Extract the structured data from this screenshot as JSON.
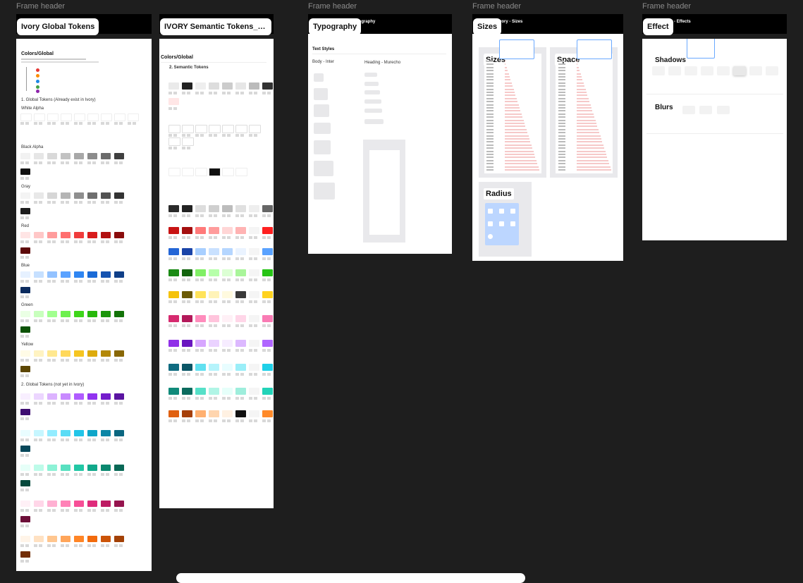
{
  "frame_header_label": "Frame header",
  "frames": {
    "global": {
      "label": "Ivory Global Tokens",
      "title": "Colors/Global",
      "section1": "1. Global Tokens (Already exist in Ivory)",
      "section2": "2. Global Tokens (not yet in Ivory)",
      "groups": [
        "White Alpha",
        "Black Alpha",
        "Gray",
        "Red",
        "Blue",
        "Green",
        "Yellow"
      ]
    },
    "semantic": {
      "label": "IVORY Semantic Tokens_li...",
      "title": "Colors/Global",
      "section": "2. Semantic Tokens"
    },
    "typography": {
      "label": "Typography",
      "section": "Text Styles",
      "col1": "Body - Inter",
      "col2": "Heading - Murecho",
      "hbar_title": "pography"
    },
    "sizes": {
      "label": "Sizes",
      "hbar_title": "vory - Sizes",
      "panels": [
        "Sizes",
        "Space",
        "Radius"
      ]
    },
    "effect": {
      "label": "Effect",
      "hbar_title": "ory - Effects",
      "panels": [
        "Shadows",
        "Blurs"
      ]
    }
  },
  "colors": {
    "canvas_bg": "#1e1e1e",
    "global_rows": [
      [
        "#ffffff",
        "#ffffff",
        "#ffffff",
        "#ffffff",
        "#ffffff",
        "#ffffff",
        "#ffffff",
        "#ffffff",
        "#ffffff"
      ],
      [
        "#f2f2f2",
        "#e6e6e6",
        "#d9d9d9",
        "#c2c2c2",
        "#a8a8a8",
        "#8c8c8c",
        "#6b6b6b",
        "#3f3f3f",
        "#111111"
      ],
      [
        "#f4f4f4",
        "#e8e8e8",
        "#d6d6d6",
        "#b5b5b5",
        "#8f8f8f",
        "#6e6e6e",
        "#525252",
        "#333333",
        "#1c1c1c"
      ],
      [
        "#ffe5e5",
        "#ffc7c7",
        "#ff9c9c",
        "#ff6f6f",
        "#f03c3c",
        "#d81c1c",
        "#b21010",
        "#8a0c0c",
        "#5c0808"
      ],
      [
        "#e6f1ff",
        "#c6e0ff",
        "#93c2ff",
        "#5aa2ff",
        "#2f86f2",
        "#1a6ad6",
        "#1552b0",
        "#103f88",
        "#0b2b5e"
      ],
      [
        "#eaffe4",
        "#c8ffbd",
        "#a1ff8f",
        "#6df04e",
        "#3ed61a",
        "#27b80b",
        "#1b960a",
        "#137308",
        "#0c5205"
      ],
      [
        "#fffbe6",
        "#fff3c2",
        "#ffe88f",
        "#ffd85a",
        "#f5c521",
        "#ddab0c",
        "#b38807",
        "#886705",
        "#5c4603"
      ],
      [
        "#f8efff",
        "#ecd6ff",
        "#dcb3ff",
        "#c88aff",
        "#b05cff",
        "#9133f0",
        "#741dcc",
        "#5a14a1",
        "#3e0d70"
      ],
      [
        "#e9fdff",
        "#c6f6ff",
        "#93ecff",
        "#5adcf5",
        "#22c5e8",
        "#0fa6c9",
        "#0b86a6",
        "#0a6680",
        "#07475a"
      ],
      [
        "#e6fff8",
        "#bdfbe9",
        "#8df2d6",
        "#58e0c0",
        "#22c7a5",
        "#10a88a",
        "#0b886f",
        "#086856",
        "#05493c"
      ],
      [
        "#fff0f6",
        "#ffd6e8",
        "#ffb0d2",
        "#ff82b7",
        "#f74f97",
        "#df2b7b",
        "#bd1b63",
        "#96144e",
        "#6c0e38"
      ],
      [
        "#fff4e8",
        "#ffe1c2",
        "#ffc68f",
        "#ffa55a",
        "#ff8526",
        "#f26a0c",
        "#cc5408",
        "#a34106",
        "#722d04"
      ]
    ],
    "semantic_rows": [
      [
        "#eaeaea",
        "#222222",
        "#eeeeee",
        "#dddddd",
        "#cccccc",
        "#e6e6e6",
        "#bbbbbb",
        "#333333",
        "#ffe6e6"
      ],
      [
        "#ffffff",
        "#ffffff",
        "#ffffff",
        "#ffffff",
        "#ffffff",
        "#ffffff",
        "#ffffff",
        "#ffffff",
        "#ffffff"
      ],
      [
        "#2a2a2a",
        "#222222",
        "#dddddd",
        "#cfcfcf",
        "#bcbcbc",
        "#e0e0e0",
        "#eeeeee",
        "#666666"
      ],
      [
        "#c81414",
        "#a40f0f",
        "#ff7a7a",
        "#ff9c9c",
        "#ffd6d6",
        "#ffb3b3",
        "#f5f5f5",
        "#ff2020"
      ],
      [
        "#2466d6",
        "#1a44a8",
        "#a8cfff",
        "#c9e1ff",
        "#b5d6ff",
        "#eaf3ff",
        "#f5f5f5",
        "#5aa2ff"
      ],
      [
        "#1a8a14",
        "#13650e",
        "#80f065",
        "#b7ffaa",
        "#dcffd4",
        "#a9f59a",
        "#f5f5f5",
        "#27c416"
      ],
      [
        "#f5c20a",
        "#6b5a05",
        "#ffe35a",
        "#fff3b8",
        "#fffadf",
        "#3a3a3a",
        "#f5f5f5",
        "#ffd21f"
      ],
      [
        "#d62a6f",
        "#b3195a",
        "#ff8cbc",
        "#ffc4dc",
        "#fff0f6",
        "#ffd6e8",
        "#f5f5f5",
        "#f97bb4"
      ],
      [
        "#9030e8",
        "#6a16c0",
        "#d7a6ff",
        "#ead2ff",
        "#f6ecff",
        "#dcb8ff",
        "#f5f5f5",
        "#b066ff"
      ],
      [
        "#0f6b80",
        "#0b5666",
        "#61e0f0",
        "#b5f3fb",
        "#e8fdff",
        "#9aeef8",
        "#f5f5f5",
        "#1fd0e8"
      ],
      [
        "#108a7a",
        "#0b6b5e",
        "#56e0c8",
        "#b0f5e6",
        "#e6fffa",
        "#9eeedc",
        "#f5f5f5",
        "#22d3b8"
      ],
      [
        "#e06010",
        "#a6400a",
        "#ffb070",
        "#ffd5ae",
        "#fff1e2",
        "#111111",
        "#f5f5f5",
        "#ff8a2a"
      ]
    ]
  }
}
